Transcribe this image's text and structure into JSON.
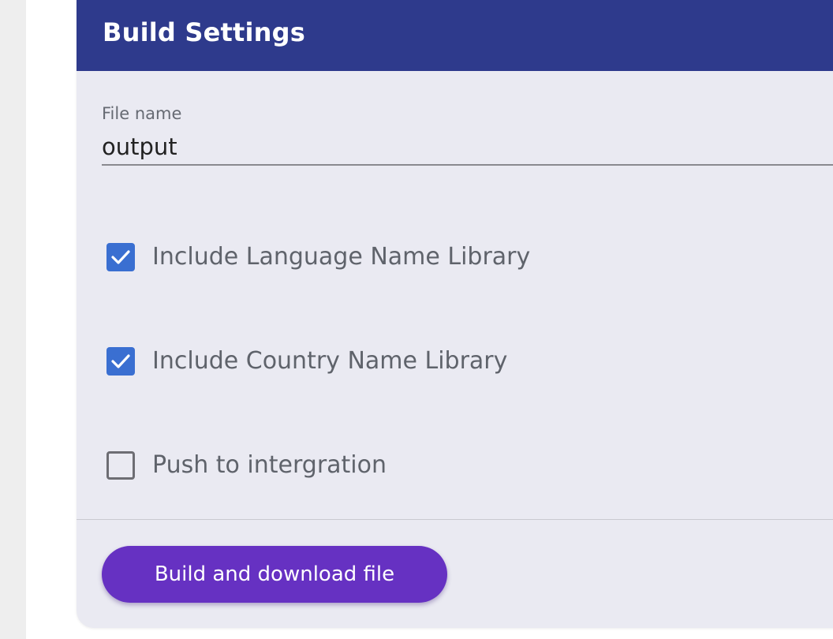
{
  "card": {
    "title": "Build Settings"
  },
  "file_field": {
    "label": "File name",
    "value": "output"
  },
  "options": [
    {
      "label": "Include Language Name Library",
      "checked": true
    },
    {
      "label": "Include Country Name Library",
      "checked": true
    },
    {
      "label": "Push to intergration",
      "checked": false
    }
  ],
  "actions": {
    "build_label": "Build and download file"
  },
  "colors": {
    "header": "#2e3a8c",
    "card_bg": "#eaeaf2",
    "checkbox_checked": "#3a6fd1",
    "button": "#6631c2"
  },
  "icons": {
    "checkbox_checked": "check-icon"
  }
}
